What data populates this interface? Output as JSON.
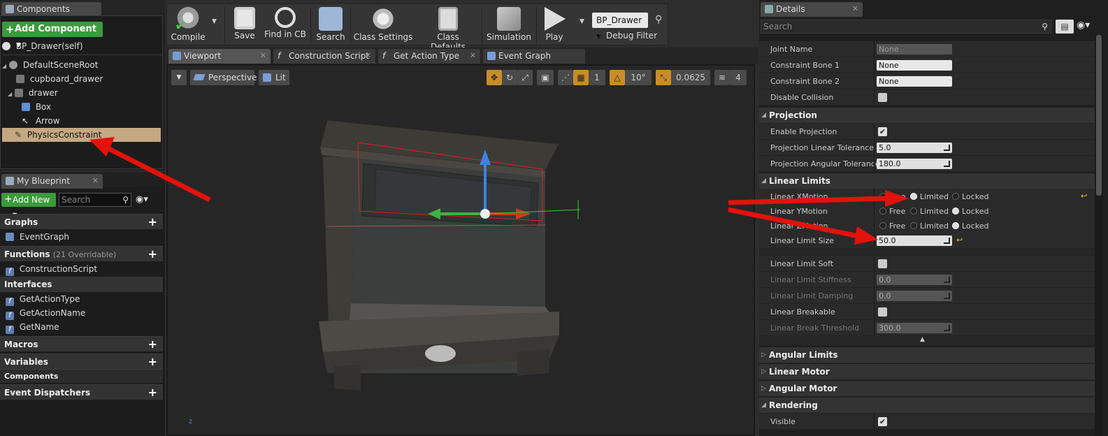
{
  "components_panel": {
    "tab_label": "Components",
    "add_button": "Add Component",
    "self_item": "BP_Drawer(self)",
    "tree": [
      {
        "label": "DefaultSceneRoot",
        "icon": "scene-root-icon"
      },
      {
        "label": "cupboard_drawer",
        "icon": "static-mesh-icon"
      },
      {
        "label": "drawer",
        "icon": "static-mesh-icon"
      },
      {
        "label": "Box",
        "icon": "box-icon"
      },
      {
        "label": "Arrow",
        "icon": "arrow-icon"
      },
      {
        "label": "PhysicsConstraint",
        "icon": "physics-constraint-icon",
        "selected": true
      }
    ]
  },
  "my_blueprint": {
    "tab_label": "My Blueprint",
    "add_new": "Add New",
    "search_placeholder": "Search",
    "sections": {
      "graphs": "Graphs",
      "functions": "Functions",
      "functions_note": "(21 Overridable)",
      "interfaces": "Interfaces",
      "macros": "Macros",
      "variables": "Variables",
      "components": "Components",
      "event_dispatchers": "Event Dispatchers"
    },
    "graphs_items": [
      "EventGraph"
    ],
    "functions_items": [
      "ConstructionScript"
    ],
    "interfaces_items": [
      "GetActionType",
      "GetActionName",
      "GetName"
    ]
  },
  "toolbar": {
    "compile": "Compile",
    "save": "Save",
    "find_in_cb": "Find in CB",
    "search": "Search",
    "class_settings": "Class Settings",
    "class_defaults": "Class Defaults",
    "simulation": "Simulation",
    "play": "Play",
    "debug_object": "BP_Drawer",
    "debug_filter": "Debug Filter"
  },
  "editor_tabs": [
    "Viewport",
    "Construction Script",
    "Get Action Type",
    "Event Graph"
  ],
  "viewport": {
    "perspective": "Perspective",
    "lit": "Lit",
    "grid_snap": "1",
    "rotation_snap": "10°",
    "scale_snap": "0.0625",
    "camera_speed": "4"
  },
  "details": {
    "tab_label": "Details",
    "search_placeholder": "Search",
    "rows_top": [
      {
        "label": "Joint Name",
        "value": "None",
        "kind": "text-dim"
      },
      {
        "label": "Constraint Bone 1",
        "value": "None",
        "kind": "text"
      },
      {
        "label": "Constraint Bone 2",
        "value": "None",
        "kind": "text"
      },
      {
        "label": "Disable Collision",
        "checked": false,
        "kind": "check"
      }
    ],
    "projection": {
      "header": "Projection",
      "enable_label": "Enable Projection",
      "enable_checked": true,
      "linear_tol_label": "Projection Linear Tolerance",
      "linear_tol_value": "5.0",
      "angular_tol_label": "Projection Angular Tolerance",
      "angular_tol_value": "180.0"
    },
    "linear_limits": {
      "header": "Linear Limits",
      "motion_options": [
        "Free",
        "Limited",
        "Locked"
      ],
      "x_motion_label": "Linear XMotion",
      "x_motion_value": "Limited",
      "y_motion_label": "Linear YMotion",
      "y_motion_value": "Locked",
      "z_motion_label": "Linear ZMotion",
      "z_motion_value": "Locked",
      "limit_size_label": "Linear Limit Size",
      "limit_size_value": "50.0",
      "limit_soft_label": "Linear Limit Soft",
      "stiffness_label": "Linear Limit Stiffness",
      "stiffness_value": "0.0",
      "damping_label": "Linear Limit Damping",
      "damping_value": "0.0",
      "breakable_label": "Linear Breakable",
      "break_threshold_label": "Linear Break Threshold",
      "break_threshold_value": "300.0"
    },
    "collapsed_sections": [
      "Angular Limits",
      "Linear Motor",
      "Angular Motor"
    ],
    "rendering": {
      "header": "Rendering",
      "visible_label": "Visible",
      "visible_checked": true
    }
  },
  "colors": {
    "accent_green": "#3b9a3b",
    "selection": "#c4a882",
    "annotation_red": "#e3120b"
  }
}
